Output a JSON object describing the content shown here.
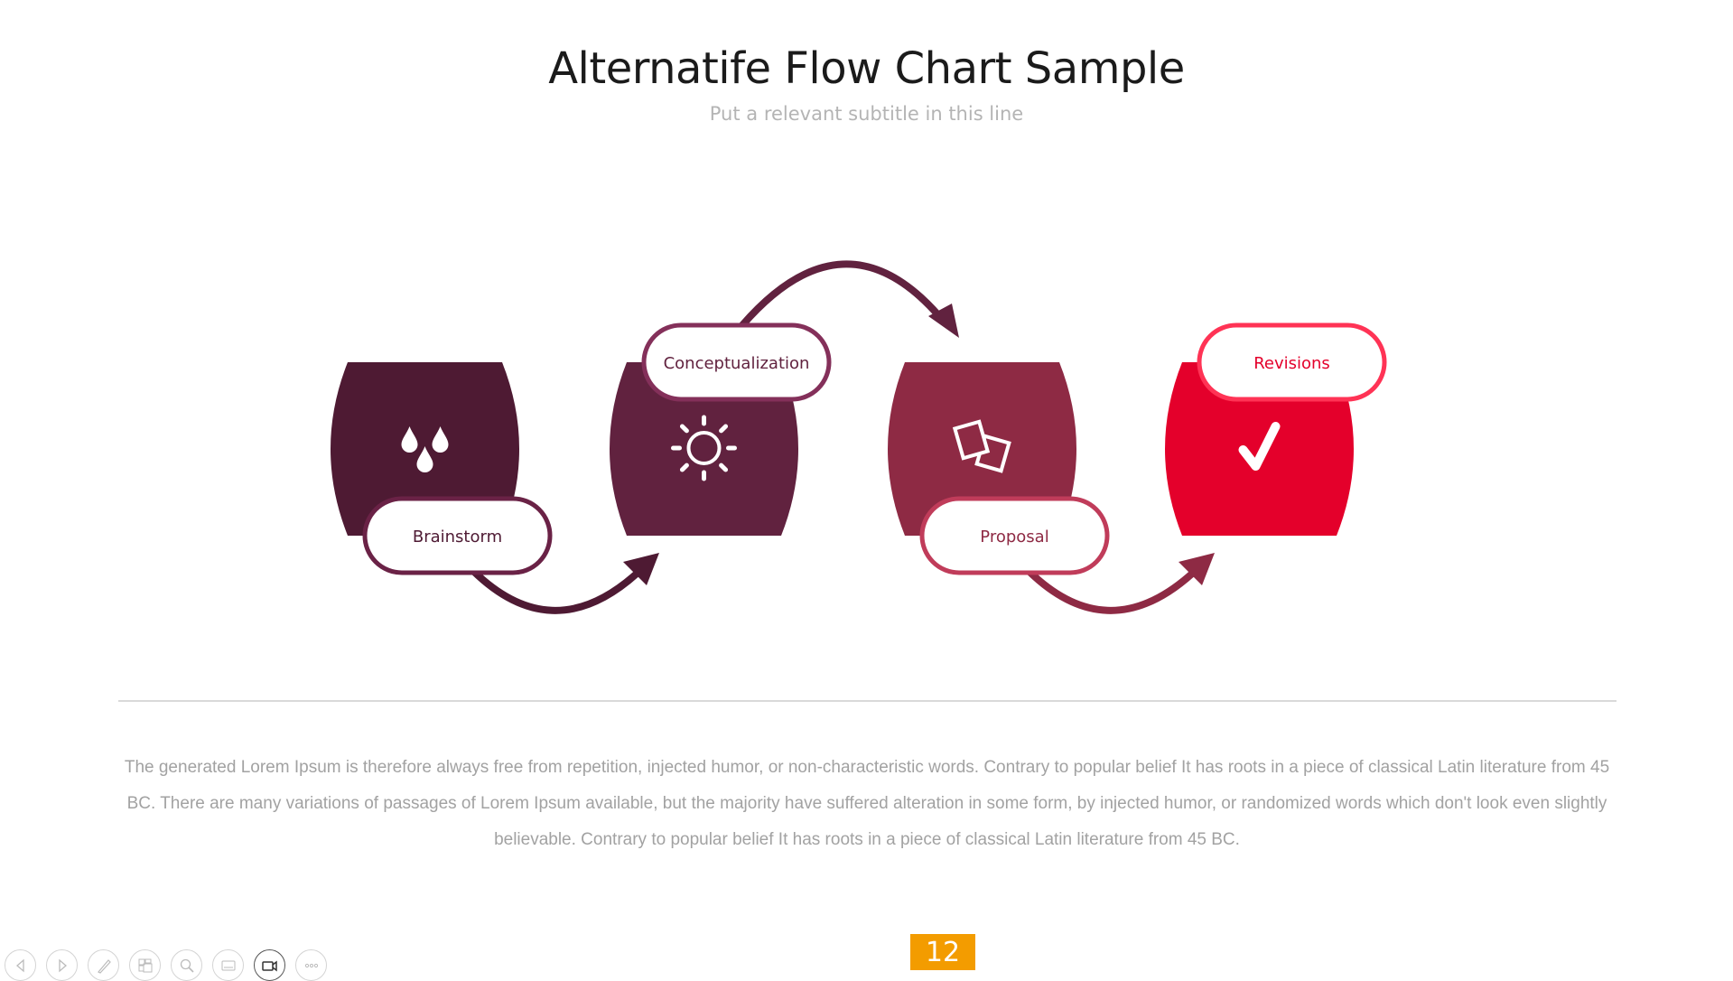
{
  "header": {
    "title": "Alternatife Flow Chart Sample",
    "subtitle": "Put a relevant subtitle in this line"
  },
  "flow": {
    "steps": [
      {
        "label": "Brainstorm",
        "icon": "raindrops-icon",
        "fill": "#4E1A33",
        "border": "#6A2246",
        "text_color": "#4E1A33"
      },
      {
        "label": "Conceptualization",
        "icon": "sun-icon",
        "fill": "#61223F",
        "border": "#84305A",
        "text_color": "#61223F"
      },
      {
        "label": "Proposal",
        "icon": "documents-icon",
        "fill": "#8E2A44",
        "border": "#C03C5A",
        "text_color": "#8E2A44"
      },
      {
        "label": "Revisions",
        "icon": "checkmark-icon",
        "fill": "#E4002B",
        "border": "#FF3355",
        "text_color": "#E4002B"
      }
    ],
    "arrow_colors": [
      "#4E1A33",
      "#61223F",
      "#8E2A44"
    ]
  },
  "body": {
    "paragraph": "The generated Lorem Ipsum is therefore always free from repetition, injected humor, or non-characteristic words. Contrary to popular belief It has roots in a piece of classical Latin literature from 45 BC. There are many variations of passages of Lorem Ipsum available, but the majority have suffered alteration in some form, by injected humor, or randomized words which don't look even slightly believable. Contrary to popular belief It has roots in a piece of classical Latin literature from 45 BC."
  },
  "footer": {
    "page_number": "12",
    "page_number_color": "#F39C00",
    "toolbar": [
      {
        "name": "previous-slide-button",
        "icon": "arrow-left-icon"
      },
      {
        "name": "next-slide-button",
        "icon": "arrow-right-icon"
      },
      {
        "name": "pen-tool-button",
        "icon": "pen-icon"
      },
      {
        "name": "slide-sorter-button",
        "icon": "slides-grid-icon"
      },
      {
        "name": "zoom-button",
        "icon": "magnifier-icon"
      },
      {
        "name": "subtitles-button",
        "icon": "subtitles-icon"
      },
      {
        "name": "camera-button",
        "icon": "video-camera-icon"
      },
      {
        "name": "more-options-button",
        "icon": "more-icon"
      }
    ]
  }
}
